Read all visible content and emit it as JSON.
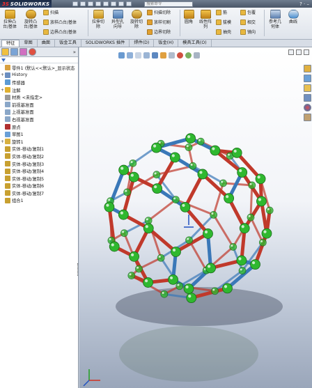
{
  "titlebar": {
    "logo_ds": "3S",
    "logo_name": "SOLIDWORKS",
    "search_placeholder": "搜索命令",
    "help": "? · –"
  },
  "ribbon": {
    "big_buttons": [
      {
        "label1": "拉伸凸",
        "label2": "台/基体"
      },
      {
        "label1": "旋转凸",
        "label2": "台/基体"
      },
      {
        "label1": "拉伸切",
        "label2": "除"
      },
      {
        "label1": "异型孔",
        "label2": "向导"
      },
      {
        "label1": "旋转切",
        "label2": "除"
      },
      {
        "label1": "圆角",
        "label2": ""
      },
      {
        "label1": "线性阵",
        "label2": "列"
      },
      {
        "label1": "参考几",
        "label2": "何体"
      },
      {
        "label1": "曲线",
        "label2": ""
      }
    ],
    "small_buttons": {
      "sweep": "扫描",
      "loft": "放样凸台/基体",
      "boundary_boss": "边界凸台/基体",
      "swept_cut": "扫描切除",
      "lofted_cut": "放样切割",
      "boundary_cut": "边界切除",
      "rib": "筋",
      "draft": "拔模",
      "shell": "抽壳",
      "wrap": "包覆",
      "intersect": "相交",
      "mirror": "镜向"
    }
  },
  "tabs": [
    "特征",
    "草图",
    "曲面",
    "钣金工具",
    "SOLIDWORKS 插件",
    "焊件(D)",
    "钣金(H)",
    "模具工具(O)"
  ],
  "active_tab": 0,
  "tree": [
    {
      "label": "零件1 (默认<<默认>_显示状态",
      "exp": "",
      "color": "#d8a040"
    },
    {
      "label": "History",
      "exp": "+",
      "color": "#6c8fc0"
    },
    {
      "label": "传感器",
      "exp": "",
      "color": "#5b9bd5"
    },
    {
      "label": "注解",
      "exp": "+",
      "color": "#e0b030"
    },
    {
      "label": "材质 <未指定>",
      "exp": "",
      "color": "#9a9a9a"
    },
    {
      "label": "前视基准面",
      "exp": "",
      "color": "#8aa7c8"
    },
    {
      "label": "上视基准面",
      "exp": "",
      "color": "#8aa7c8"
    },
    {
      "label": "右视基准面",
      "exp": "",
      "color": "#8aa7c8"
    },
    {
      "label": "原点",
      "exp": "",
      "color": "#b03030"
    },
    {
      "label": "草图1",
      "exp": "",
      "color": "#6aa0d8"
    },
    {
      "label": "旋转1",
      "exp": "+",
      "color": "#d8b040"
    },
    {
      "label": "实体-移动/复制1",
      "exp": "",
      "color": "#c8a030"
    },
    {
      "label": "实体-移动/复制2",
      "exp": "",
      "color": "#c8a030"
    },
    {
      "label": "实体-移动/复制3",
      "exp": "",
      "color": "#c8a030"
    },
    {
      "label": "实体-移动/复制4",
      "exp": "",
      "color": "#c8a030"
    },
    {
      "label": "实体-移动/复制5",
      "exp": "",
      "color": "#c8a030"
    },
    {
      "label": "实体-移动/复制6",
      "exp": "",
      "color": "#c8a030"
    },
    {
      "label": "实体-移动/复制7",
      "exp": "",
      "color": "#c8a030"
    },
    {
      "label": "组合1",
      "exp": "",
      "color": "#c8a030"
    }
  ],
  "colors": {
    "atom": "#2fb82f",
    "bond_red": "#c0392b",
    "bond_blue": "#3a78b8"
  }
}
